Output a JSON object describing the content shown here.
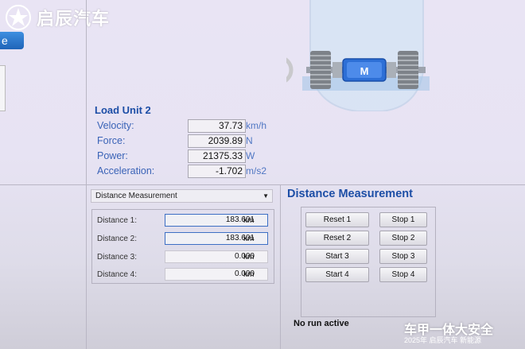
{
  "brand": {
    "logo_text": "启辰汽车"
  },
  "left_tab": {
    "label": "e"
  },
  "load_unit": {
    "title": "Load Unit 2",
    "rows": [
      {
        "label": "Velocity:",
        "value": "37.73",
        "unit": "km/h"
      },
      {
        "label": "Force:",
        "value": "2039.89",
        "unit": "N"
      },
      {
        "label": "Power:",
        "value": "21375.33",
        "unit": "W"
      },
      {
        "label": "Acceleration:",
        "value": "-1.702",
        "unit": "m/s2"
      }
    ]
  },
  "motor_label": "M",
  "dropdown": {
    "selected": "Distance Measurement"
  },
  "section_title": "Distance Measurement",
  "distances": [
    {
      "label": "Distance 1:",
      "value": "183.601",
      "unit": "km"
    },
    {
      "label": "Distance 2:",
      "value": "183.601",
      "unit": "km"
    },
    {
      "label": "Distance 3:",
      "value": "0.000",
      "unit": "km"
    },
    {
      "label": "Distance 4:",
      "value": "0.000",
      "unit": "km"
    }
  ],
  "buttons": {
    "left": [
      "Reset 1",
      "Reset 2",
      "Start 3",
      "Start 4"
    ],
    "right": [
      "Stop 1",
      "Stop 2",
      "Stop 3",
      "Stop 4"
    ]
  },
  "status": "No run active",
  "watermark": {
    "line1": "车甲一体大安全",
    "line2": "2025年 启辰汽车 新能源"
  }
}
